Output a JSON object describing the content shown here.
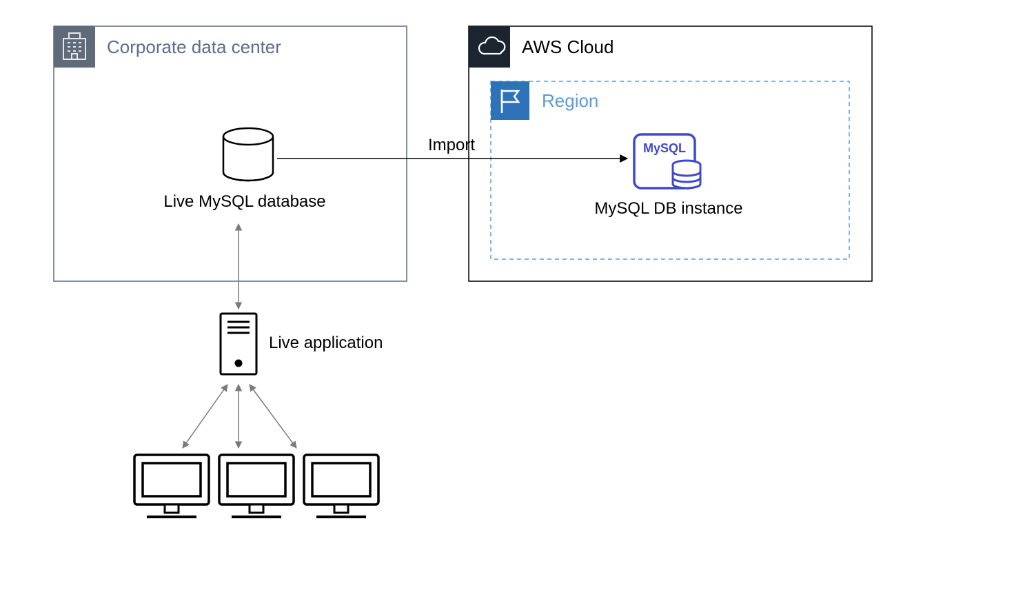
{
  "corporate": {
    "title": "Corporate data center",
    "db_label": "Live MySQL database",
    "app_label": "Live application",
    "title_color": "#5A6B8C",
    "header_fill": "#5F6B7A",
    "border_color": "#5A6B8C"
  },
  "aws": {
    "title": "AWS Cloud",
    "header_fill": "#1A2530",
    "border_color": "#000000",
    "region": {
      "title": "Region",
      "title_color": "#5B9BD5",
      "header_fill": "#2E73B8",
      "border_color": "#5B9BD5",
      "rds": {
        "label": "MySQL DB instance",
        "badge": "MySQL",
        "color": "#3F48CC"
      }
    }
  },
  "arrow_import_label": "Import"
}
